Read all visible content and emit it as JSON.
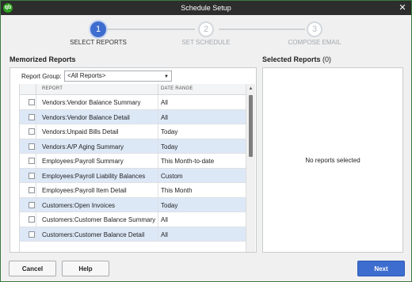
{
  "window": {
    "title": "Schedule Setup",
    "app_logo": "qb",
    "close_glyph": "✕"
  },
  "stepper": {
    "steps": [
      {
        "number": "1",
        "label": "SELECT REPORTS",
        "state": "active"
      },
      {
        "number": "2",
        "label": "SET SCHEDULE",
        "state": "inactive"
      },
      {
        "number": "3",
        "label": "COMPOSE EMAIL",
        "state": "inactive"
      }
    ]
  },
  "memorized": {
    "title": "Memorized Reports",
    "group_label": "Report Group:",
    "group_value": "<All Reports>",
    "columns": [
      "REPORT",
      "DATE RANGE"
    ],
    "rows": [
      {
        "report": "Vendors:Vendor Balance Summary",
        "range": "All"
      },
      {
        "report": "Vendors:Vendor Balance Detail",
        "range": "All"
      },
      {
        "report": "Vendors:Unpaid Bills Detail",
        "range": "Today"
      },
      {
        "report": "Vendors:A/P Aging Summary",
        "range": "Today"
      },
      {
        "report": "Employees:Payroll Summary",
        "range": "This Month-to-date"
      },
      {
        "report": "Employees:Payroll Liability Balances",
        "range": "Custom"
      },
      {
        "report": "Employees:Payroll Item Detail",
        "range": "This Month"
      },
      {
        "report": "Customers:Open Invoices",
        "range": "Today"
      },
      {
        "report": "Customers:Customer Balance Summary",
        "range": "All"
      },
      {
        "report": "Customers:Customer Balance Detail",
        "range": "All"
      }
    ]
  },
  "selected": {
    "title": "Selected Reports",
    "count": "(0)",
    "empty_message": "No reports selected"
  },
  "footer": {
    "cancel": "Cancel",
    "help": "Help",
    "next": "Next"
  },
  "colors": {
    "accent": "#3d6dce",
    "row_alt": "#dde8f7",
    "title_bar": "#2d2d2d",
    "logo": "#2ca01c"
  }
}
